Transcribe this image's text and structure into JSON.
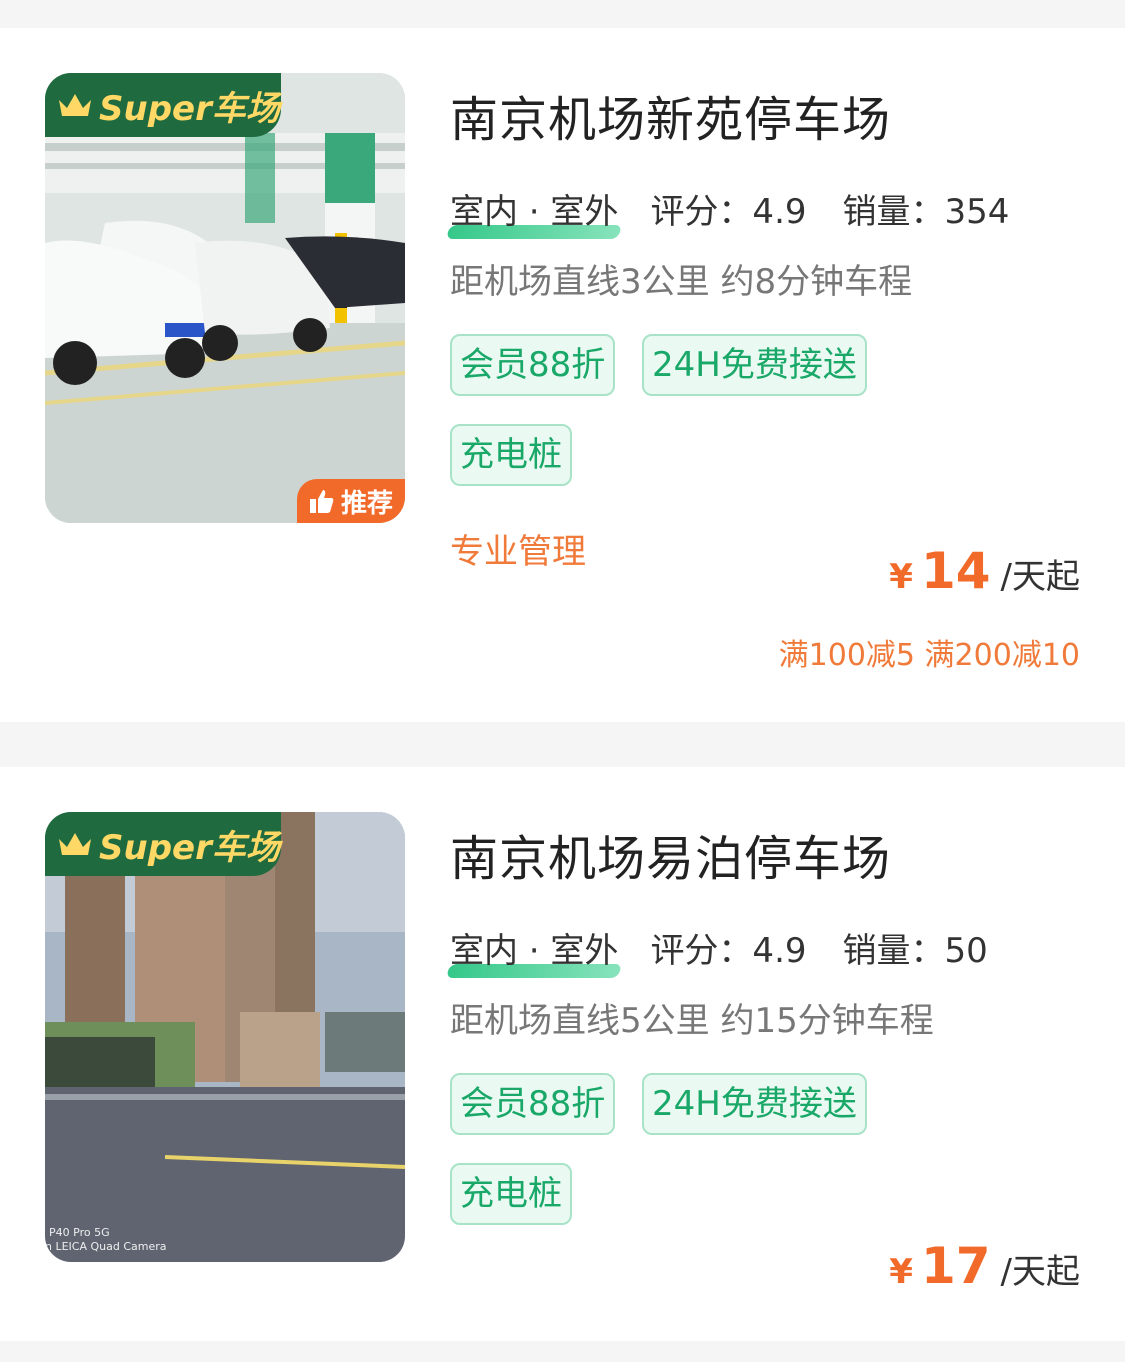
{
  "lots": [
    {
      "badge_super": "Super车场",
      "badge_recommend": "推荐",
      "title": "南京机场新苑停车场",
      "environment": "室内 · 室外",
      "rating_text": "评分：4.9",
      "sales_text": "销量：354",
      "distance": "距机场直线3公里 约8分钟车程",
      "tags": [
        "会员88折",
        "24H免费接送",
        "充电桩"
      ],
      "management": "专业管理",
      "price_symbol": "¥",
      "price": "14",
      "price_unit": "/天起",
      "promo": "满100减5 满200减10"
    },
    {
      "badge_super": "Super车场",
      "title": "南京机场易泊停车场",
      "environment": "室内 · 室外",
      "rating_text": "评分：4.9",
      "sales_text": "销量：50",
      "distance": "距机场直线5公里 约15分钟车程",
      "tags": [
        "会员88折",
        "24H免费接送",
        "充电桩"
      ],
      "price_symbol": "¥",
      "price": "17",
      "price_unit": "/天起",
      "photo_watermark": "P40 Pro 5G\nn LEICA Quad Camera"
    }
  ],
  "colors": {
    "accent_green": "#1aa869",
    "badge_green": "#1f6b3f",
    "badge_gold": "#ffd866",
    "accent_orange": "#f26a2a"
  },
  "icons": [
    "crown-icon",
    "thumbs-up-icon"
  ]
}
